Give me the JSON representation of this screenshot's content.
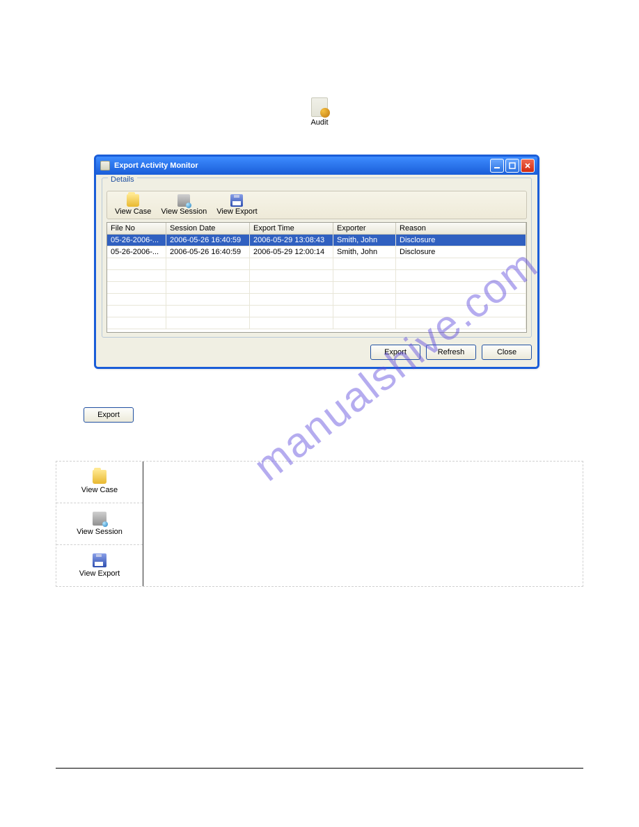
{
  "audit": {
    "label": "Audit"
  },
  "dialog": {
    "title": "Export Activity Monitor",
    "group_label": "Details",
    "toolbar": [
      {
        "label": "View Case"
      },
      {
        "label": "View Session"
      },
      {
        "label": "View Export"
      }
    ],
    "columns": [
      "File No",
      "Session Date",
      "Export Time",
      "Exporter",
      "Reason"
    ],
    "rows": [
      {
        "file_no": "05-26-2006-...",
        "session_date": "2006-05-26 16:40:59",
        "export_time": "2006-05-29 13:08:43",
        "exporter": "Smith, John",
        "reason": "Disclosure",
        "selected": true
      },
      {
        "file_no": "05-26-2006-...",
        "session_date": "2006-05-26 16:40:59",
        "export_time": "2006-05-29 12:00:14",
        "exporter": "Smith, John",
        "reason": "Disclosure",
        "selected": false
      }
    ],
    "buttons": {
      "export": "Export",
      "refresh": "Refresh",
      "close": "Close"
    }
  },
  "lone_export": "Export",
  "side": {
    "items": [
      {
        "label": "View Case"
      },
      {
        "label": "View Session"
      },
      {
        "label": "View Export"
      }
    ]
  },
  "watermark": "manualshive.com"
}
